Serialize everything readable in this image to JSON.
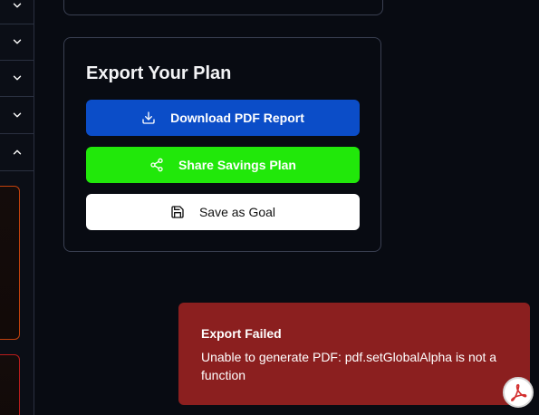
{
  "sidebar": {
    "items": [
      {
        "icon": "chevron-down-icon"
      },
      {
        "icon": "chevron-down-icon"
      },
      {
        "icon": "chevron-down-icon"
      },
      {
        "icon": "chevron-down-icon"
      },
      {
        "icon": "chevron-up-icon"
      }
    ]
  },
  "export": {
    "title": "Export Your Plan",
    "download_label": "Download PDF Report",
    "share_label": "Share Savings Plan",
    "goal_label": "Save as Goal"
  },
  "toast": {
    "title": "Export Failed",
    "message": "Unable to generate PDF: pdf.setGlobalAlpha is not a function"
  },
  "colors": {
    "background": "#080b12",
    "card_border": "#3a4052",
    "download_button": "#0b4dc8",
    "share_button": "#21e80a",
    "goal_button": "#ffffff",
    "toast_background": "#8b1f1f",
    "pdf_icon": "#d32f2f"
  },
  "icons": {
    "download": "download-icon",
    "share": "share-icon",
    "save": "save-icon",
    "pdf": "pdf-icon"
  }
}
